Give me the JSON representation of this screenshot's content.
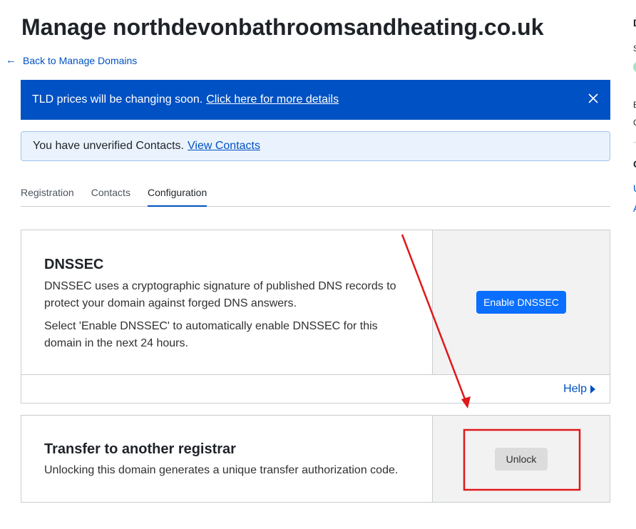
{
  "page": {
    "title": "Manage northdevonbathroomsandheating.co.uk",
    "back_link": "Back to Manage Domains"
  },
  "banner": {
    "text": "TLD prices will be changing soon.",
    "link": "Click here for more details"
  },
  "info_banner": {
    "text": "You have unverified Contacts.",
    "link": "View Contacts"
  },
  "tabs": [
    {
      "label": "Registration"
    },
    {
      "label": "Contacts"
    },
    {
      "label": "Configuration",
      "active": true
    }
  ],
  "dnssec": {
    "heading": "DNSSEC",
    "para1": "DNSSEC uses a cryptographic signature of published DNS records to protect your domain against forged DNS answers.",
    "para2": "Select 'Enable DNSSEC' to automatically enable DNSSEC for this domain in the next 24 hours.",
    "button": "Enable DNSSEC",
    "help": "Help"
  },
  "transfer": {
    "heading": "Transfer to another registrar",
    "para": "Unlocking this domain generates a unique transfer authorization code.",
    "button": "Unlock"
  },
  "right_column": {
    "fragments": [
      "D",
      "S",
      "E",
      "C",
      "C",
      "U",
      "A"
    ]
  },
  "colors": {
    "accent": "#0051c3",
    "button_primary": "#0a6ffe",
    "annotation": "#e0181b",
    "status_dot": "#a6e3c8"
  },
  "icons": {
    "back": "arrow-left-icon",
    "close": "close-icon",
    "help": "caret-right-icon"
  }
}
